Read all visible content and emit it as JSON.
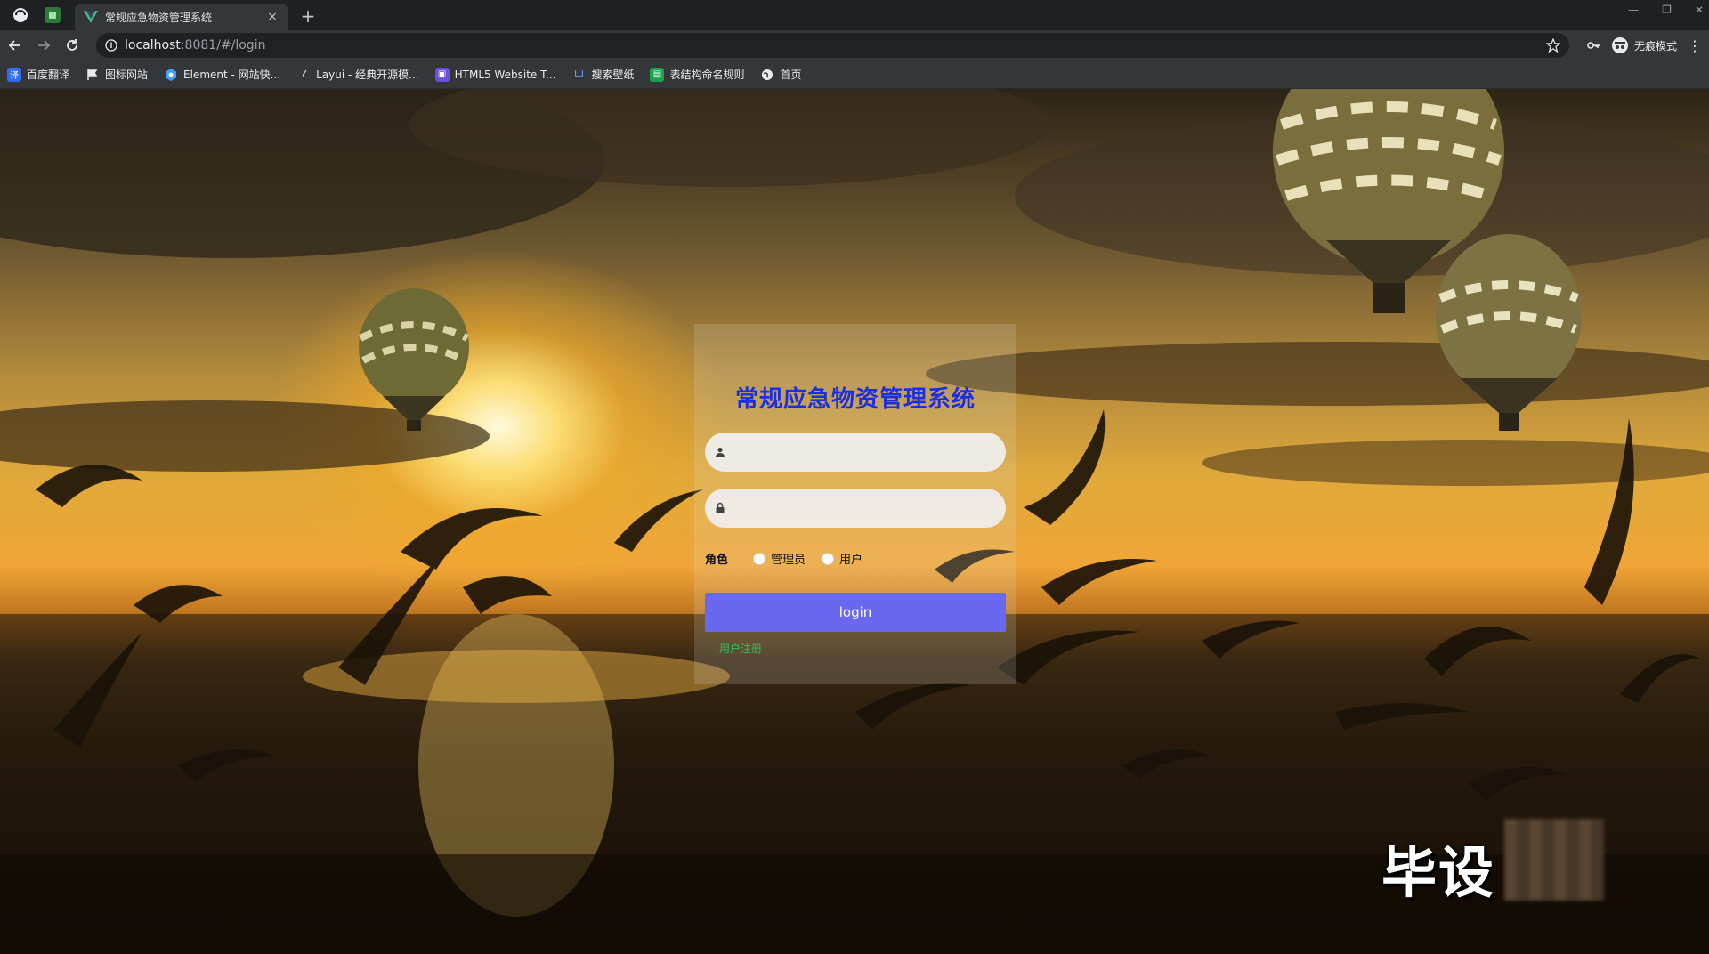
{
  "browser": {
    "tab_title": "常规应急物资管理系统",
    "tab_close": "×",
    "new_tab": "+",
    "url_host": "localhost",
    "url_path": ":8081/#/login",
    "incognito_label": "无痕模式",
    "bookmarks": [
      {
        "label": "百度翻译",
        "icon": "baidu-translate-icon",
        "color": "#2f6df6"
      },
      {
        "label": "图标网站",
        "icon": "flag-icon",
        "color": "#444444"
      },
      {
        "label": "Element - 网站快...",
        "icon": "element-hexagon-icon",
        "color": "#409eff"
      },
      {
        "label": "Layui - 经典开源模...",
        "icon": "layui-icon",
        "color": "#555555"
      },
      {
        "label": "HTML5 Website T...",
        "icon": "html5-template-icon",
        "color": "#6b4fd8"
      },
      {
        "label": "搜索壁纸",
        "icon": "wallpaper-icon",
        "color": "#3b5bdb"
      },
      {
        "label": "表结构命名规则",
        "icon": "table-icon",
        "color": "#1aa34a"
      },
      {
        "label": "首页",
        "icon": "globe-icon",
        "color": "#6c6c6c"
      }
    ]
  },
  "login": {
    "title": "常规应急物资管理系统",
    "username_placeholder": "",
    "password_placeholder": "",
    "role_label": "角色",
    "roles": [
      "管理员",
      "用户"
    ],
    "button_label": "login",
    "register_link": "用户注册"
  },
  "watermark": {
    "text": "毕设"
  },
  "colors": {
    "title": "#1b2ee6",
    "button": "#6b68f0",
    "link": "#2ec15a"
  }
}
